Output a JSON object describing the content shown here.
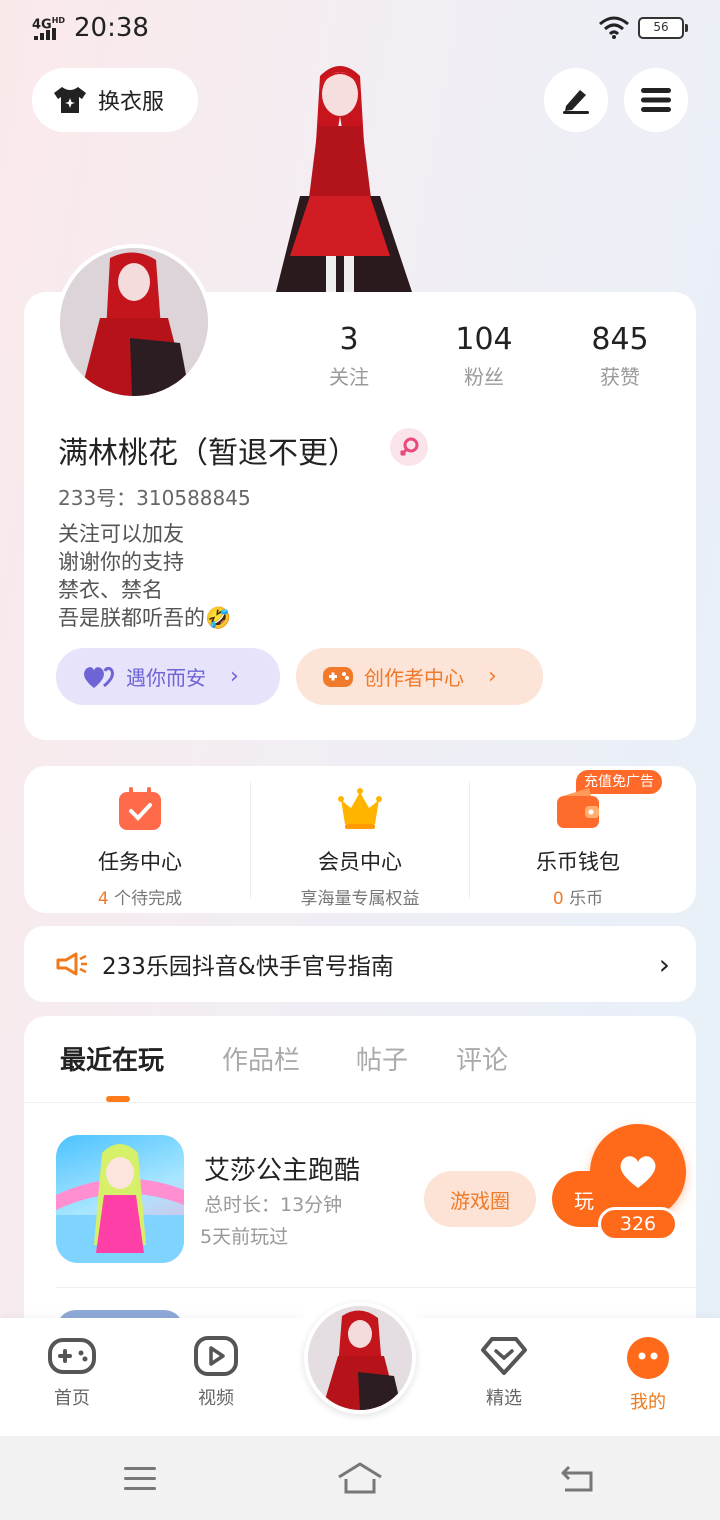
{
  "status_bar": {
    "network": "4G",
    "network_sup": "HD",
    "time": "20:38",
    "battery": "56"
  },
  "top": {
    "outfit_label": "换衣服",
    "icons": {
      "outfit": "shirt-sparkle-icon",
      "edit": "pencil-icon",
      "menu": "hamburger-menu-icon"
    }
  },
  "profile": {
    "stats": [
      {
        "value": "3",
        "label": "关注"
      },
      {
        "value": "104",
        "label": "粉丝"
      },
      {
        "value": "845",
        "label": "获赞"
      }
    ],
    "nickname": "满林桃花（暂退不更）",
    "gender_icon": "female-icon",
    "uid": "233号：310588845",
    "bio": [
      "关注可以加友",
      "谢谢你的支持",
      "禁衣、禁名",
      "吾是朕都听吾的🤣"
    ],
    "pill_love": "遇你而安",
    "pill_creator": "创作者中心"
  },
  "quick": {
    "badge": "充值免广告",
    "items": [
      {
        "title": "任务中心",
        "sub_num": "4",
        "sub_text": " 个待完成",
        "icon": "calendar-check-icon"
      },
      {
        "title": "会员中心",
        "sub_num": "",
        "sub_text": "享海量专属权益",
        "icon": "crown-icon"
      },
      {
        "title": "乐币钱包",
        "sub_num": "0",
        "sub_text": " 乐币",
        "icon": "wallet-icon"
      }
    ]
  },
  "banner": {
    "text": "233乐园抖音&快手官号指南",
    "icon": "megaphone-icon"
  },
  "tabs": [
    "最近在玩",
    "作品栏",
    "帖子",
    "评论"
  ],
  "recent_game": {
    "name": "艾莎公主跑酷",
    "total_time": "总时长：13分钟",
    "last_played": "5天前玩过",
    "btn_circle": "游戏圈",
    "btn_play": "玩"
  },
  "like": {
    "count": "326"
  },
  "bottom_nav": [
    {
      "label": "首页",
      "icon": "gamepad-icon"
    },
    {
      "label": "视频",
      "icon": "video-play-icon"
    },
    {
      "label": "精选",
      "icon": "heart-diamond-icon"
    },
    {
      "label": "我的",
      "icon": "face-icon"
    }
  ],
  "colors": {
    "accent": "#ff6a1a",
    "purple": "#6f64d6"
  }
}
